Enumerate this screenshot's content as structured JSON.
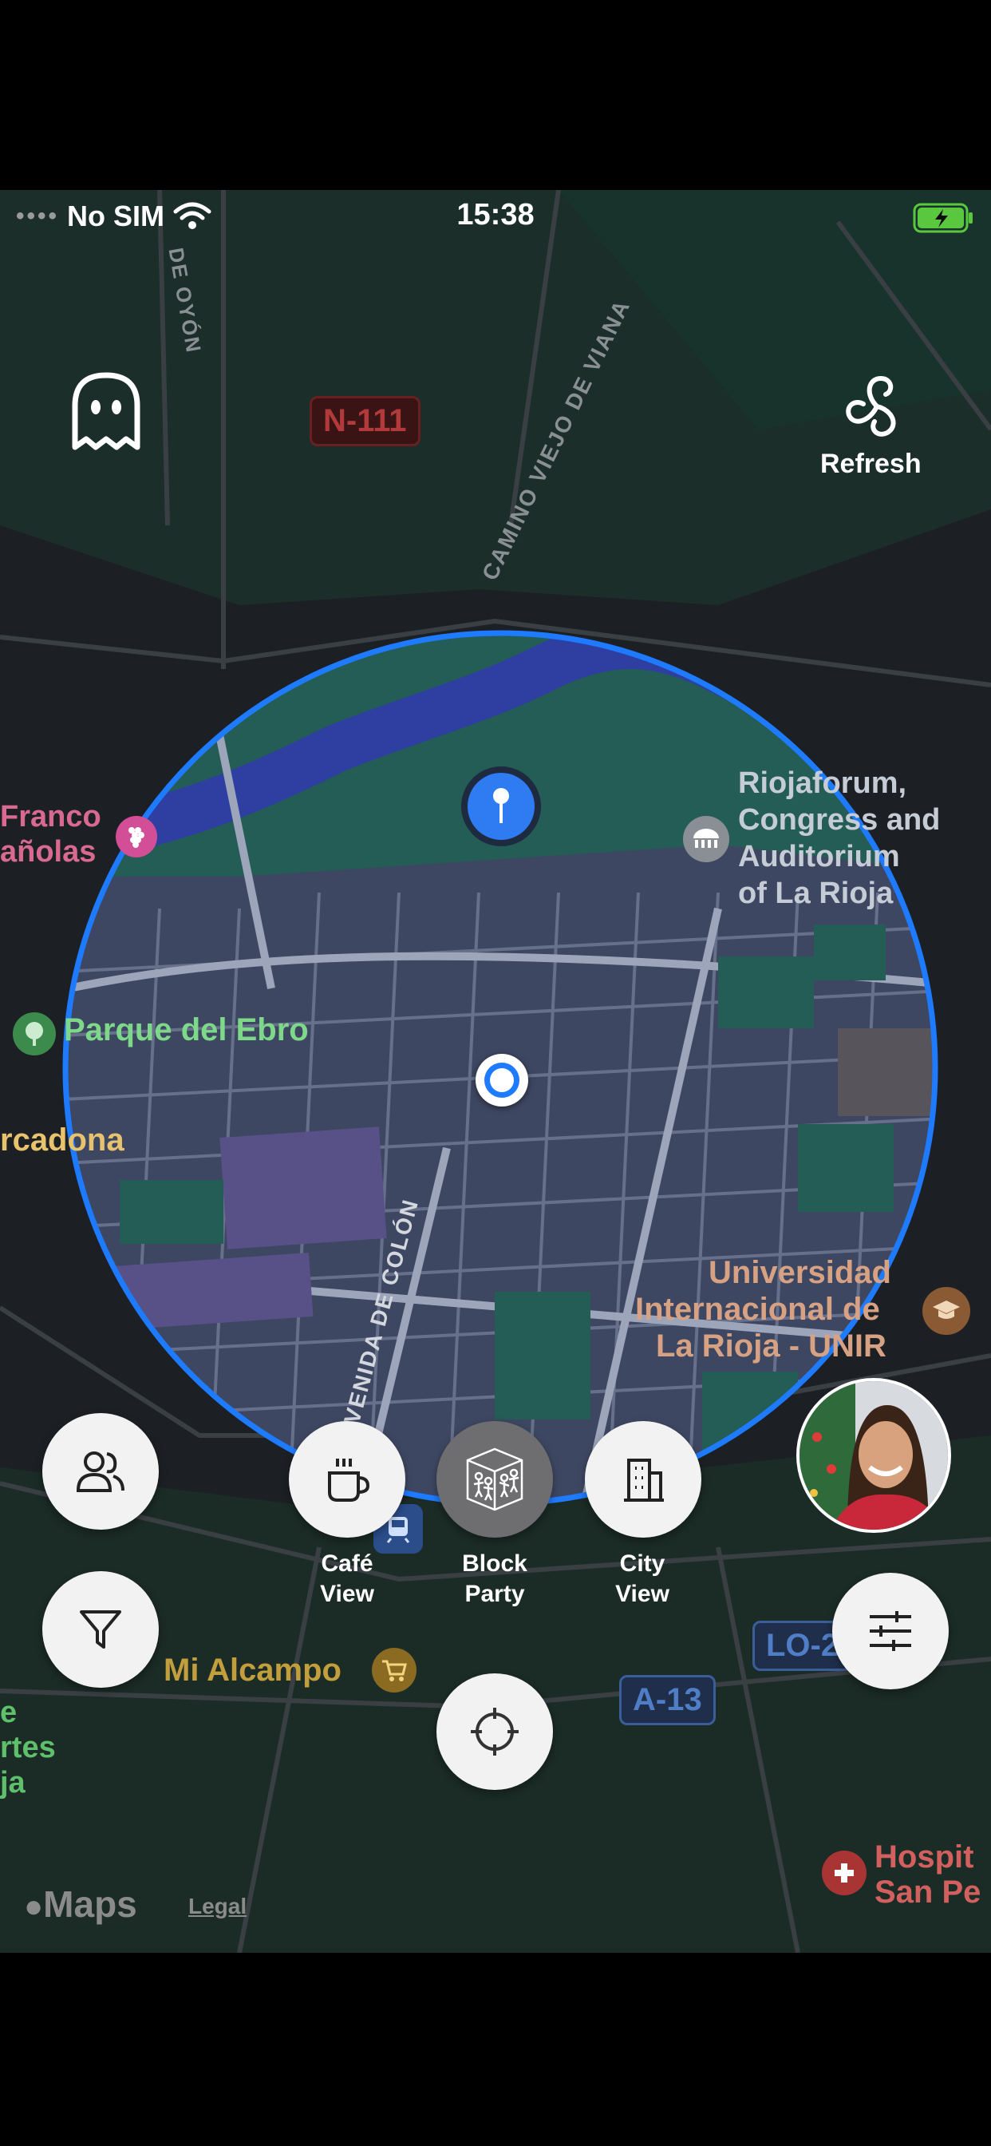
{
  "status_bar": {
    "carrier": "No SIM",
    "time": "15:38"
  },
  "top_bar": {
    "ghost_icon": "ghost-icon",
    "refresh_label": "Refresh"
  },
  "map": {
    "road_labels": {
      "n111": "N-111",
      "camino": "CAMINO VIEJO DE VIANA",
      "oyon": "DE OYÓN",
      "colon": "AVENIDA DE COLÓN",
      "a13": "A-13",
      "lo2": "LO-2"
    },
    "places": {
      "riojaforum_1": "Riojaforum,",
      "riojaforum_2": "Congress and",
      "riojaforum_3": "Auditorium",
      "riojaforum_4": "of La Rioja",
      "franco": "Franco",
      "espanolas": "añolas",
      "parque": "Parque del Ebro",
      "mercadona": "rcadona",
      "unir_1": "Universidad",
      "unir_2": "Internacional de",
      "unir_3": "La Rioja - UNIR",
      "alcampo": "Mi Alcampo",
      "hospital_1": "Hospit",
      "hospital_2": "San Pe",
      "left_frag_1": "e",
      "left_frag_2": "rtes",
      "left_frag_3": "ja"
    },
    "attribution": {
      "maps": "Maps",
      "legal": "Legal"
    }
  },
  "controls": {
    "cafe_view": "Café\nView",
    "block_party": "Block\nParty",
    "city_view": "City\nView"
  },
  "colors": {
    "radius_ring": "#1e7bff",
    "button_bg": "#f2f2f2",
    "selected_bg": "#6e6e70",
    "park": "#1f5a4a",
    "river": "#2b3aa0"
  }
}
